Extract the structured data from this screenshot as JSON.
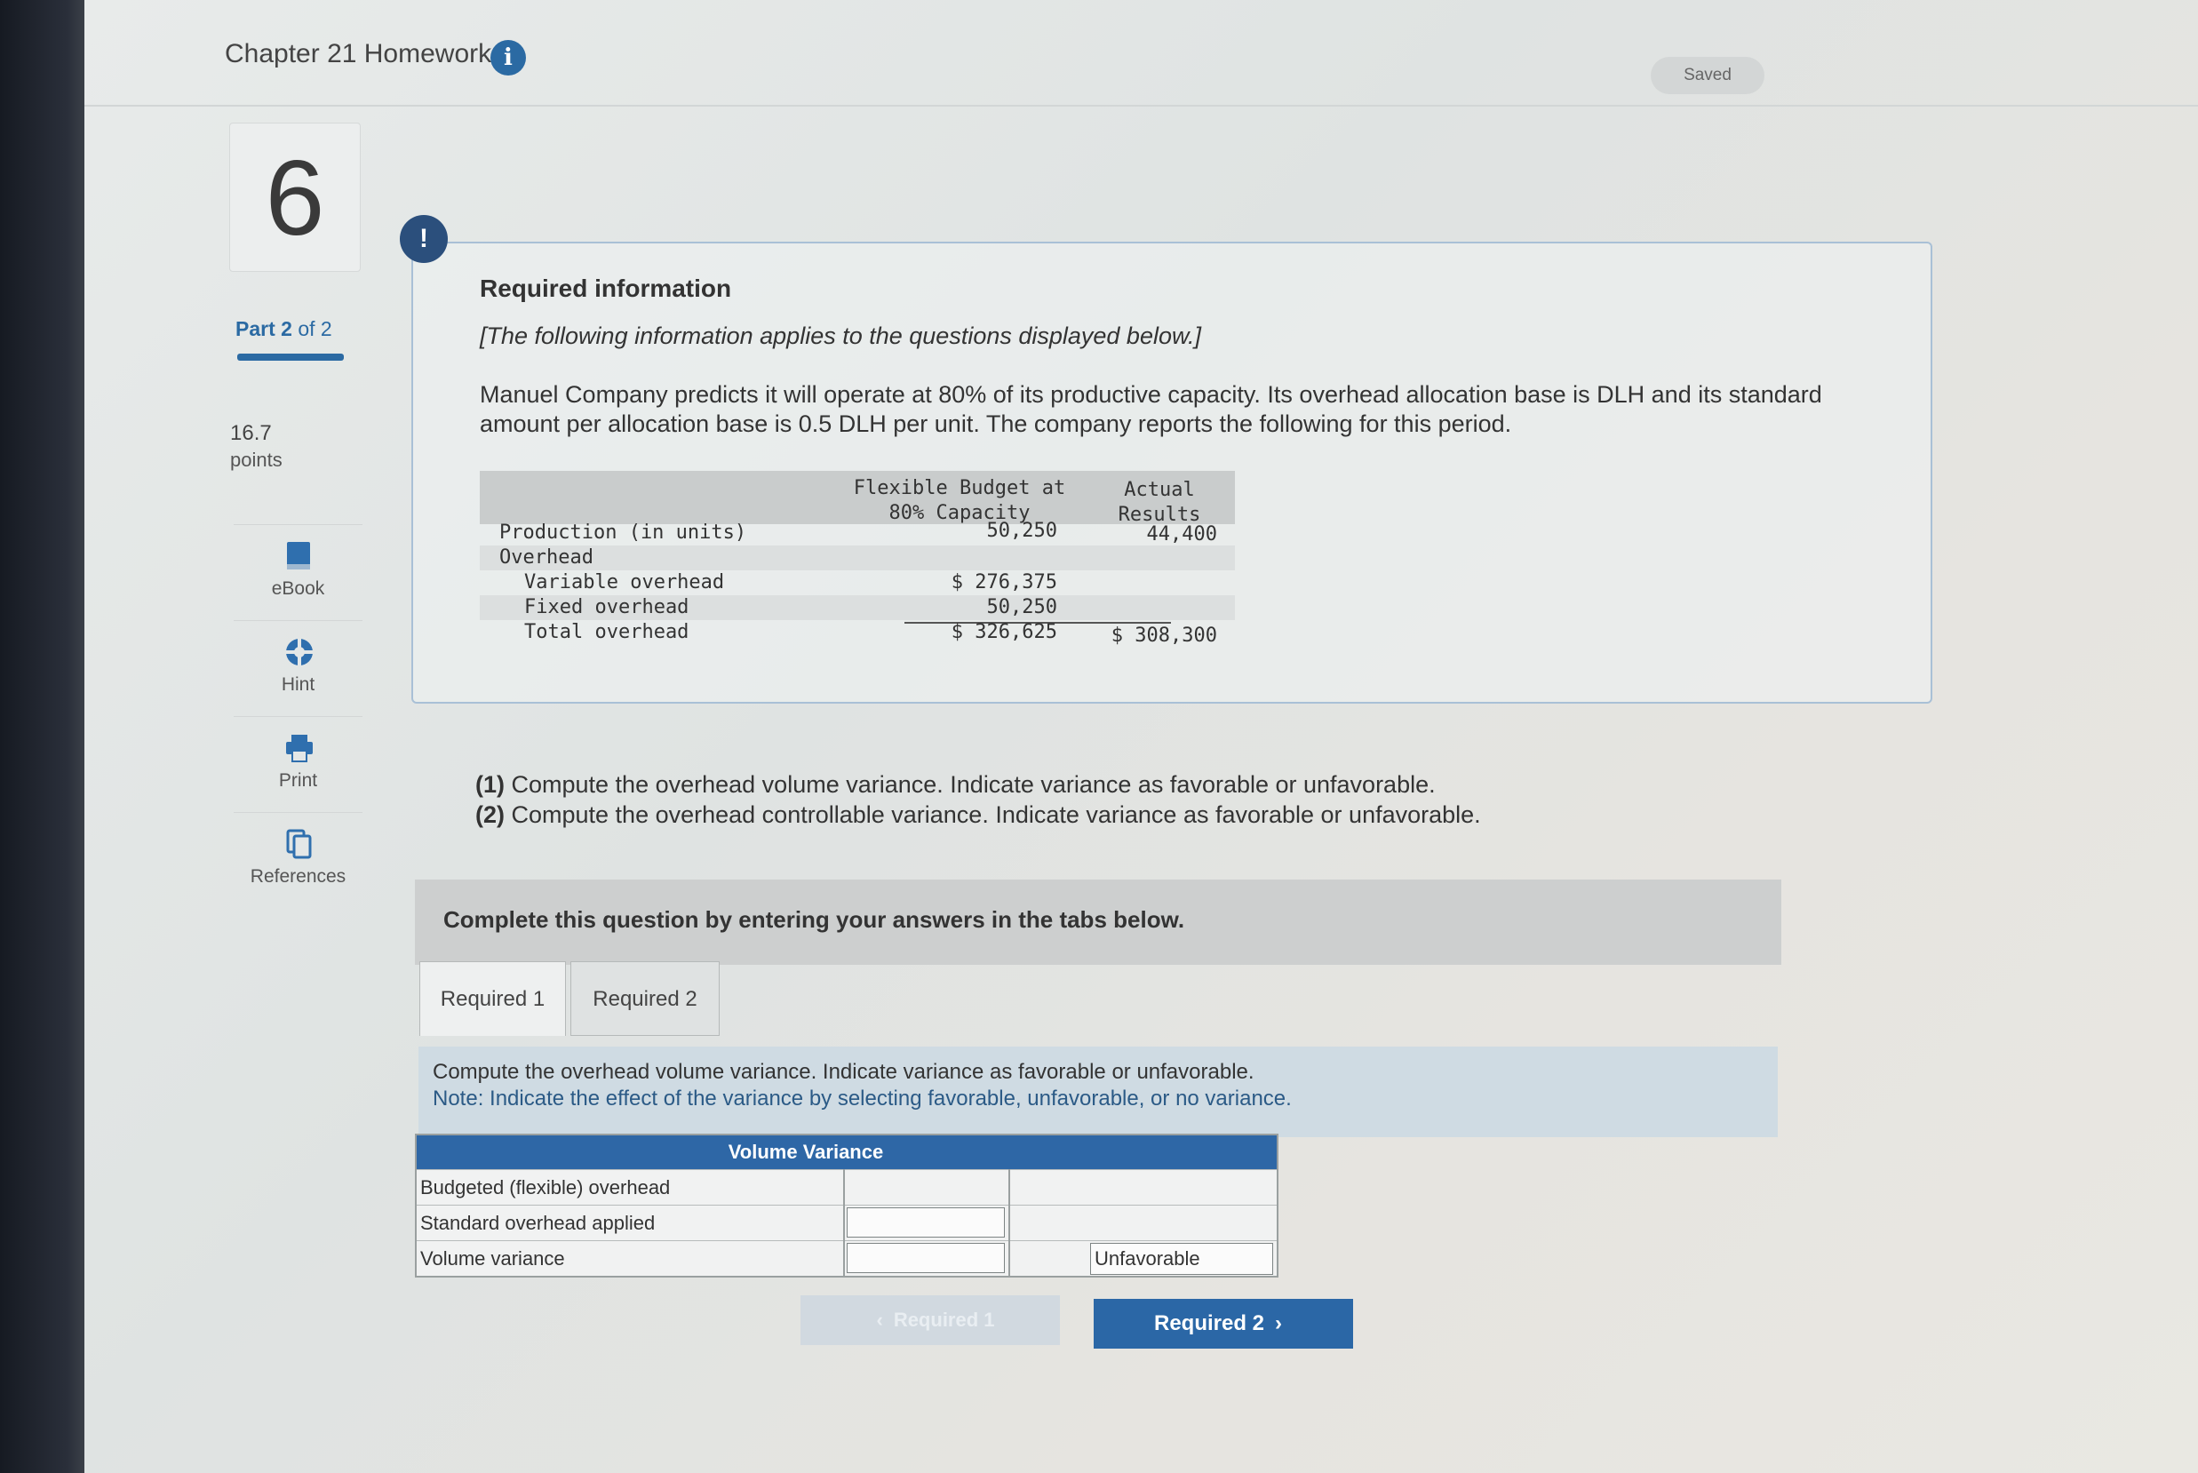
{
  "header": {
    "title": "Chapter 21 Homework",
    "info_icon": "info-icon",
    "saved_label": "Saved"
  },
  "sidebar": {
    "question_number": "6",
    "part_prefix": "Part 2",
    "part_suffix": " of 2",
    "points_value": "16.7",
    "points_label": "points",
    "tools": [
      {
        "label": "eBook",
        "icon": "book-icon"
      },
      {
        "label": "Hint",
        "icon": "lifebuoy-icon"
      },
      {
        "label": "Print",
        "icon": "printer-icon"
      },
      {
        "label": "References",
        "icon": "documents-icon"
      }
    ]
  },
  "required_info": {
    "alert": "!",
    "title": "Required information",
    "subtitle": "[The following information applies to the questions displayed below.]",
    "body": "Manuel Company predicts it will operate at 80% of its productive capacity. Its overhead allocation base is DLH and its standard amount per allocation base is 0.5 DLH per unit. The company reports the following for this period.",
    "table": {
      "col1_line1": "Flexible Budget at",
      "col1_line2": "80% Capacity",
      "col2_line1": "Actual",
      "col2_line2": "Results",
      "rows": [
        {
          "label": "Production (in units)",
          "budget": "50,250",
          "actual": "44,400"
        },
        {
          "label": "Overhead",
          "budget": "",
          "actual": ""
        },
        {
          "label": "Variable overhead",
          "budget": "$ 276,375",
          "actual": ""
        },
        {
          "label": "Fixed overhead",
          "budget": "50,250",
          "actual": ""
        },
        {
          "label": "Total overhead",
          "budget": "$ 326,625",
          "actual": "$ 308,300"
        }
      ]
    }
  },
  "questions": {
    "q1_num": "(1)",
    "q1_text": " Compute the overhead volume variance. Indicate variance as favorable or unfavorable.",
    "q2_num": "(2)",
    "q2_text": " Compute the overhead controllable variance. Indicate variance as favorable or unfavorable."
  },
  "complete_bar": "Complete this question by entering your answers in the tabs below.",
  "tabs": [
    {
      "label": "Required 1",
      "active": true
    },
    {
      "label": "Required 2",
      "active": false
    }
  ],
  "instructions": {
    "line1": "Compute the overhead volume variance. Indicate variance as favorable or unfavorable.",
    "note": "Note: Indicate the effect of the variance by selecting favorable, unfavorable, or no variance."
  },
  "volume_variance": {
    "header": "Volume Variance",
    "rows": [
      {
        "label": "Budgeted (flexible) overhead",
        "value": "",
        "effect": ""
      },
      {
        "label": "Standard overhead applied",
        "value": "",
        "effect": ""
      },
      {
        "label": "Volume variance",
        "value": "",
        "effect": "Unfavorable"
      }
    ]
  },
  "nav": {
    "prev_label": "Required 1",
    "next_label": "Required 2"
  }
}
